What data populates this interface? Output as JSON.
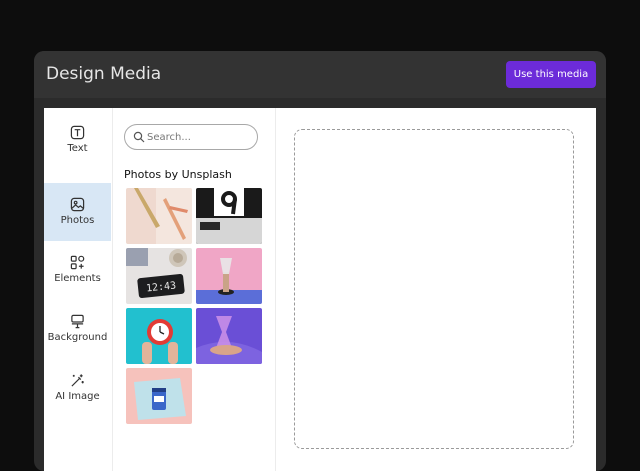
{
  "window": {
    "title": "Design Media",
    "use_button_label": "Use this media",
    "accent_color": "#6c2bd9"
  },
  "sidebar": {
    "items": [
      {
        "label": "Text",
        "icon": "text-box-icon",
        "active": false
      },
      {
        "label": "Photos",
        "icon": "image-icon",
        "active": true
      },
      {
        "label": "Elements",
        "icon": "shapes-icon",
        "active": false
      },
      {
        "label": "Background",
        "icon": "paint-roller-icon",
        "active": false
      },
      {
        "label": "AI Image",
        "icon": "magic-wand-icon",
        "active": false
      }
    ],
    "active_color": "#d8e7f5"
  },
  "media": {
    "search_placeholder": "Search...",
    "section_title": "Photos by Unsplash",
    "photos": [
      {
        "icon": "pens-on-peach-photo"
      },
      {
        "icon": "black-number-nine-photo"
      },
      {
        "icon": "clock-on-desk-photo",
        "text": "12:43"
      },
      {
        "icon": "hand-with-glass-photo"
      },
      {
        "icon": "hand-holding-red-clock-photo"
      },
      {
        "icon": "hand-with-purple-hourglass-photo"
      },
      {
        "icon": "blue-jar-on-pink-photo"
      }
    ]
  }
}
